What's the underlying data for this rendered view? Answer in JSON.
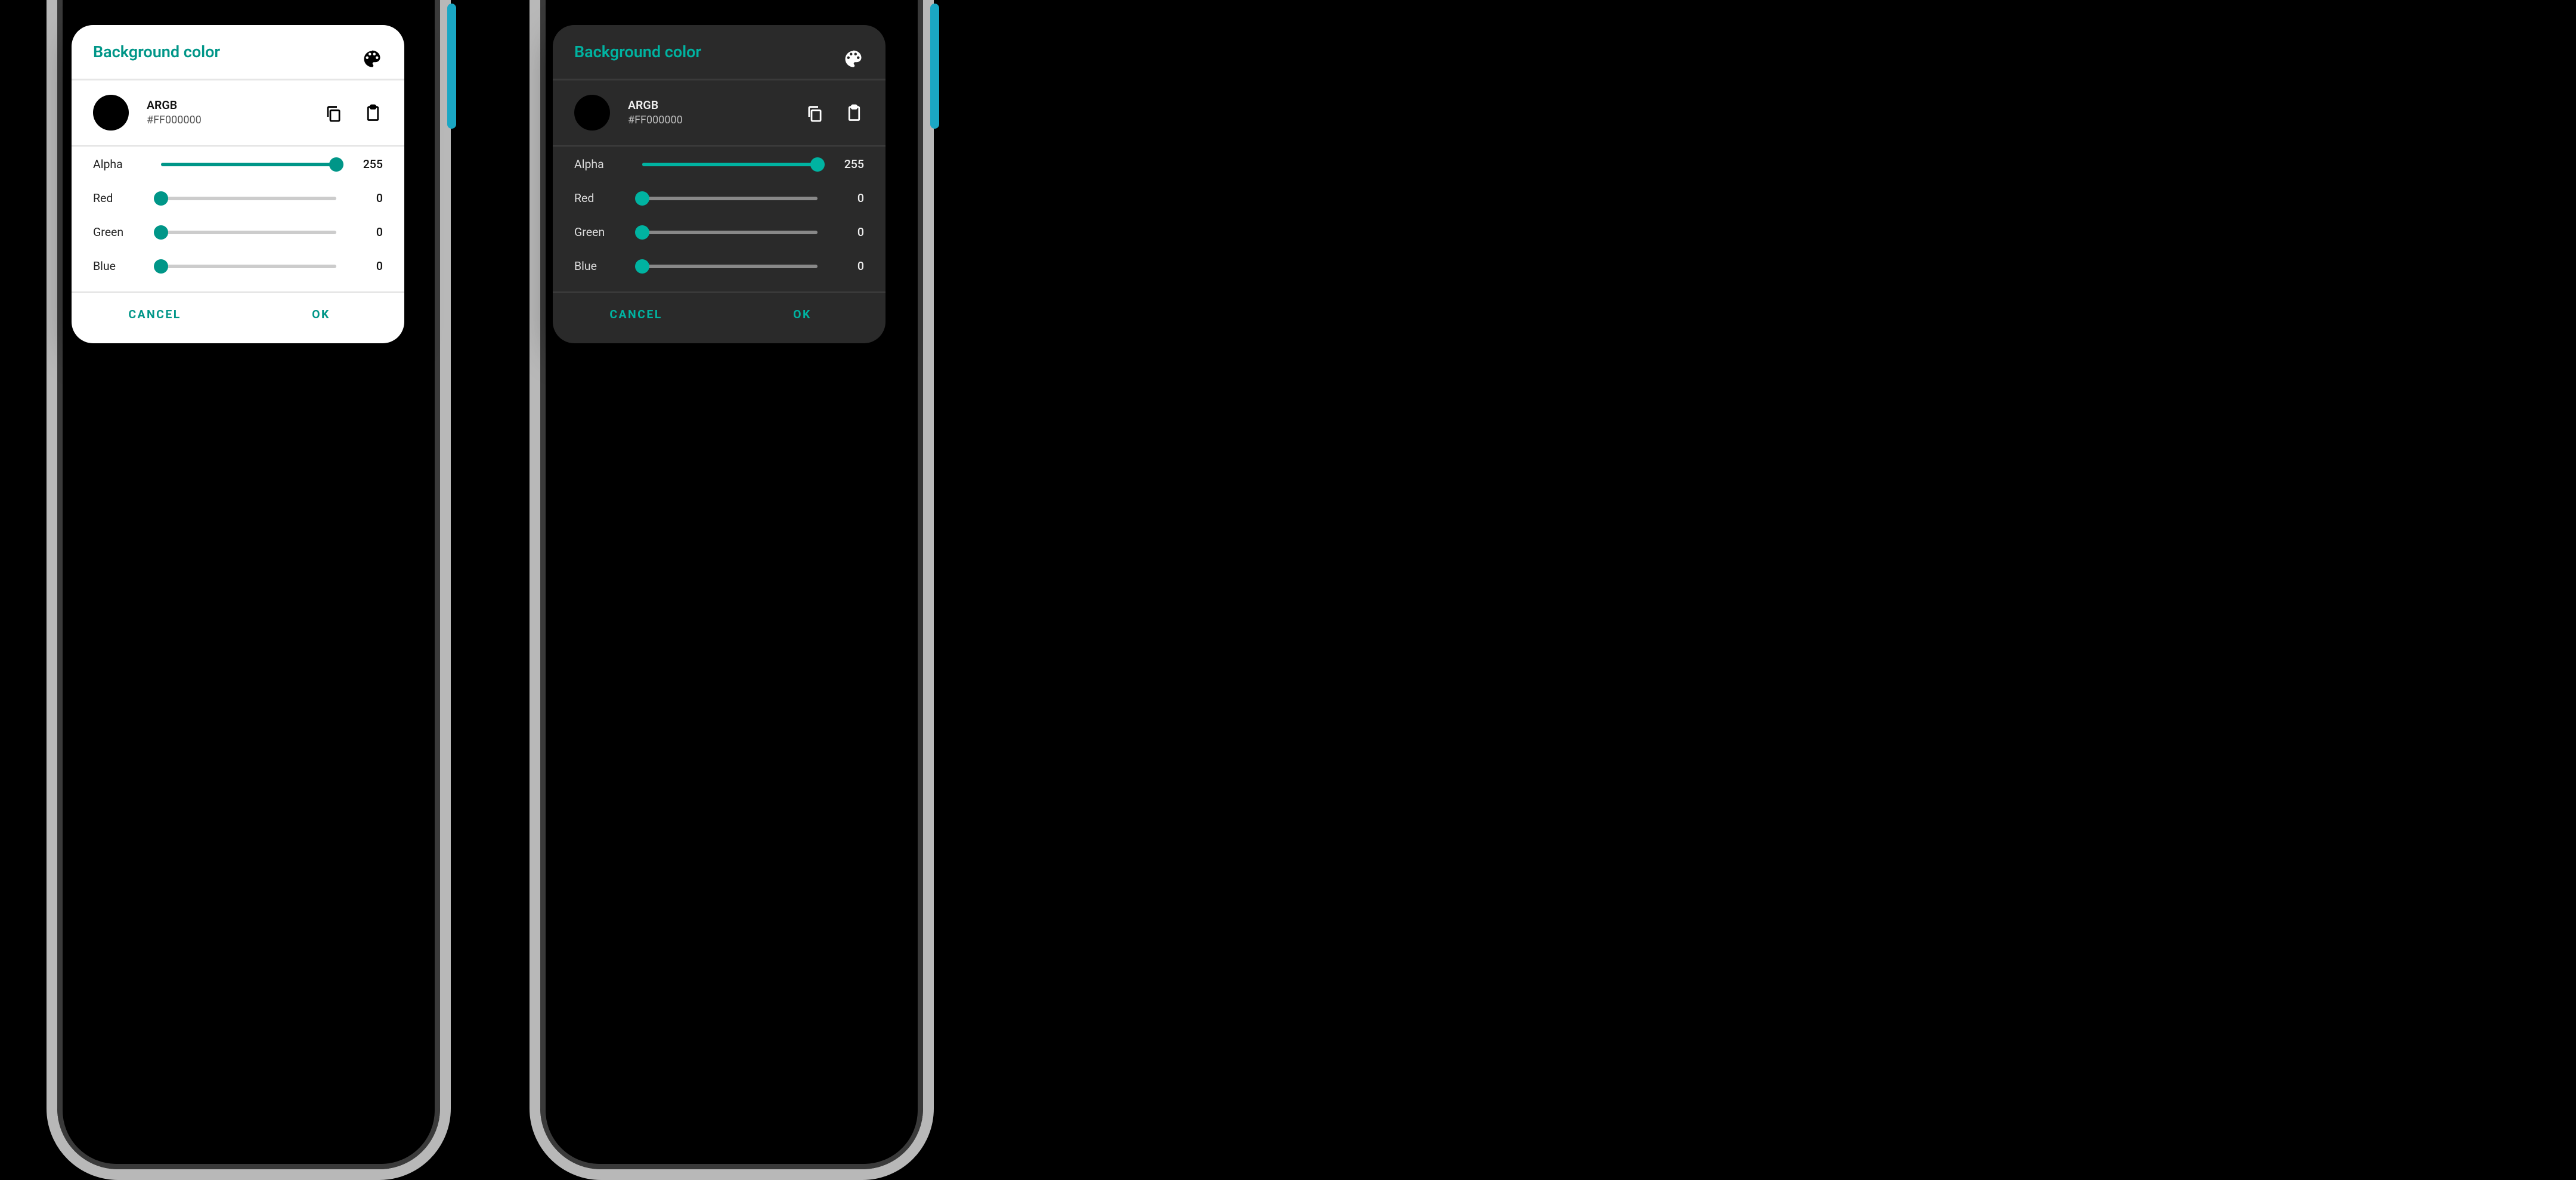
{
  "dialogs": [
    {
      "theme": "light",
      "title": "Background color",
      "preview": {
        "label": "ARGB",
        "value": "#FF000000",
        "swatch_color": "#000000"
      },
      "sliders": [
        {
          "label": "Alpha",
          "value": 255,
          "max": 255
        },
        {
          "label": "Red",
          "value": 0,
          "max": 255
        },
        {
          "label": "Green",
          "value": 0,
          "max": 255
        },
        {
          "label": "Blue",
          "value": 0,
          "max": 255
        }
      ],
      "actions": {
        "cancel": "CANCEL",
        "ok": "OK"
      }
    },
    {
      "theme": "dark",
      "title": "Background color",
      "preview": {
        "label": "ARGB",
        "value": "#FF000000",
        "swatch_color": "#000000"
      },
      "sliders": [
        {
          "label": "Alpha",
          "value": 255,
          "max": 255
        },
        {
          "label": "Red",
          "value": 0,
          "max": 255
        },
        {
          "label": "Green",
          "value": 0,
          "max": 255
        },
        {
          "label": "Blue",
          "value": 0,
          "max": 255
        }
      ],
      "actions": {
        "cancel": "CANCEL",
        "ok": "OK"
      }
    }
  ],
  "accent_light": "#009688",
  "accent_dark": "#00b3a1"
}
